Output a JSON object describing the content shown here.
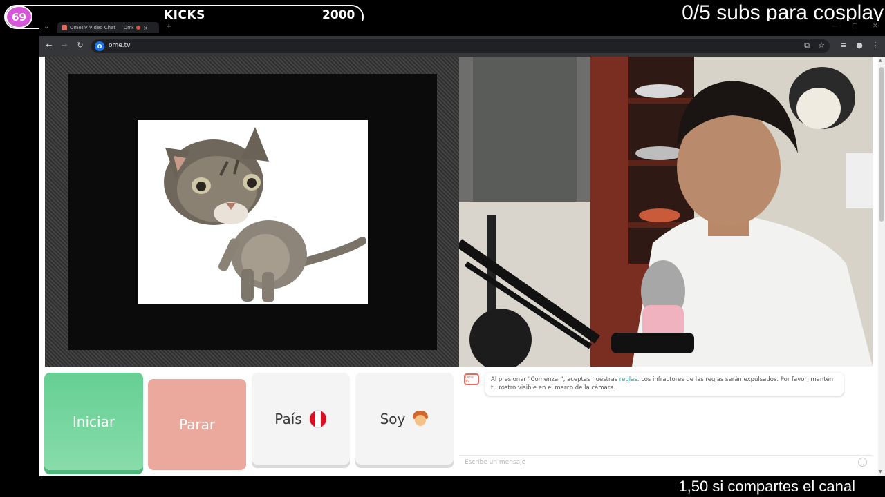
{
  "overlay": {
    "kicks_count": "69",
    "kicks_label": "KICKS",
    "kicks_goal": "2000",
    "subs_goal": "0/5 subs para cosplay",
    "share_note": "1,50 si compartes el canal"
  },
  "browser": {
    "tab_title": "OmeTV Video Chat — Ome",
    "tab_close": "×",
    "new_tab": "+",
    "url": "ome.tv",
    "icons": [
      "back-icon",
      "forward-icon",
      "reload-icon",
      "install-icon",
      "star-icon",
      "extensions-icon",
      "profile-icon",
      "menu-icon"
    ]
  },
  "controls": {
    "start_label": "Iniciar",
    "stop_label": "Parar",
    "country_label": "País",
    "gender_label": "Soy",
    "colors": {
      "start": "#65cf93",
      "stop": "#eba89c",
      "neutral": "#f4f4f4"
    }
  },
  "chat": {
    "logo_text": "Ome TV",
    "message_before": "Al presionar \"Comenzar\", aceptas nuestras ",
    "message_link": "reglas",
    "message_after": ". Los infractores de las reglas serán expulsados. Por favor, mantén tu rostro visible en el marco de la cámara.",
    "input_placeholder": "Escribe un mensaje",
    "link_color": "#2aa198"
  }
}
